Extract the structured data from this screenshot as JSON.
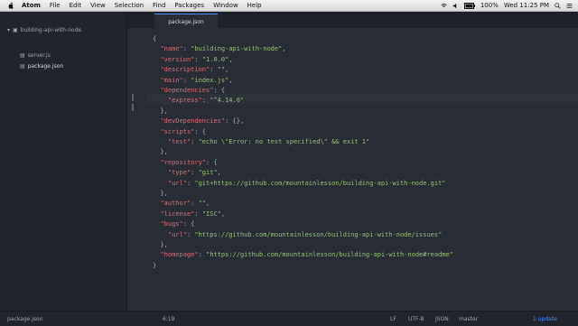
{
  "menubar": {
    "app": "Atom",
    "items": [
      "File",
      "Edit",
      "View",
      "Selection",
      "Find",
      "Packages",
      "Window",
      "Help"
    ],
    "battery": "100%",
    "clock": "Wed 11:25 PM"
  },
  "tree": {
    "root": "building-api-with-node",
    "files": [
      "server.js",
      "package.json"
    ]
  },
  "tab": {
    "title": "package.json"
  },
  "editor": {
    "lines": [
      "{",
      "  \"name\": \"building-api-with-node\",",
      "  \"version\": \"1.0.0\",",
      "  \"description\": \"\",",
      "  \"main\": \"index.js\",",
      "  \"dependencies\": {",
      "    \"express\": \"^4.14.0\"",
      "  },",
      "  \"devDependencies\": {},",
      "  \"scripts\": {",
      "    \"test\": \"echo \\\"Error: no test specified\\\" && exit 1\"",
      "  },",
      "  \"repository\": {",
      "    \"type\": \"git\",",
      "    \"url\": \"git+https://github.com/mountainlesson/building-api-with-node.git\"",
      "  },",
      "  \"author\": \"\",",
      "  \"license\": \"ISC\",",
      "  \"bugs\": {",
      "    \"url\": \"https://github.com/mountainlesson/building-api-with-node/issues\"",
      "  },",
      "  \"homepage\": \"https://github.com/mountainlesson/building-api-with-node#readme\"",
      "}"
    ]
  },
  "status": {
    "file": "package.json",
    "cursor": "6:19",
    "line_ending": "LF",
    "encoding": "UTF-8",
    "grammar": "JSON",
    "branch": "master",
    "updates": "1 update"
  },
  "colors": {
    "accent": "#528bff",
    "key": "#e06c75",
    "string": "#98c379"
  }
}
